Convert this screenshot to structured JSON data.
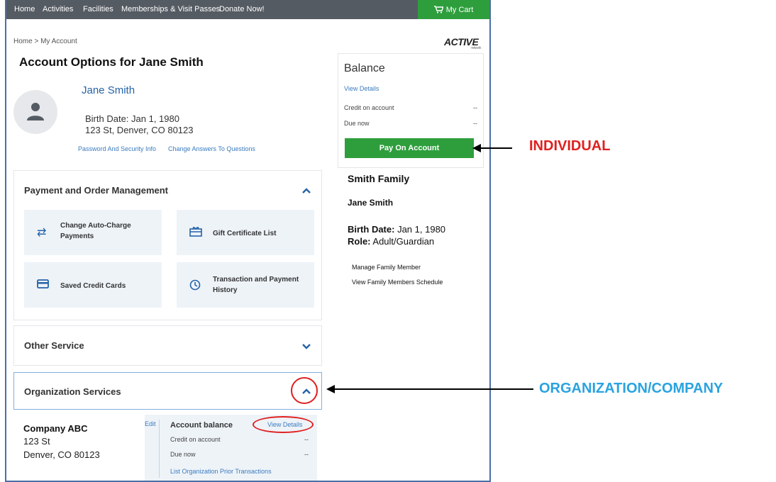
{
  "nav": {
    "items": [
      "Home",
      "Activities",
      "Facilities",
      "Memberships & Visit Passes",
      "Donate Now!"
    ],
    "cart": "My Cart"
  },
  "breadcrumb": "Home > My Account",
  "logo": {
    "text": "ACTIVE",
    "sub": "network"
  },
  "page_title": "Account Options for Jane Smith",
  "profile": {
    "name": "Jane Smith",
    "birth": "Birth Date: Jan 1, 1980",
    "address": "123 St, Denver, CO 80123",
    "link_password": "Password And Security Info",
    "link_answers": "Change Answers To Questions"
  },
  "payment_panel": {
    "title": "Payment and Order Management",
    "tiles": {
      "auto_charge": "Change Auto-Charge Payments",
      "gift": "Gift Certificate List",
      "cards": "Saved Credit Cards",
      "history": "Transaction and Payment History"
    }
  },
  "other_panel": {
    "title": "Other Service"
  },
  "org_panel": {
    "title": "Organization Services"
  },
  "org": {
    "name": "Company ABC",
    "street": "123 St",
    "city": "Denver, CO 80123",
    "edit": "Edit",
    "balance_title": "Account balance",
    "view_details": "View Details",
    "credit_label": "Credit on account",
    "credit_value": "--",
    "due_label": "Due now",
    "due_value": "--",
    "prior": "List Organization Prior Transactions"
  },
  "balance": {
    "title": "Balance",
    "view_details": "View Details",
    "credit_label": "Credit on account",
    "credit_value": "--",
    "due_label": "Due now",
    "due_value": "--",
    "pay_button": "Pay On Account"
  },
  "family": {
    "name": "Smith Family",
    "member": "Jane Smith",
    "birth_label": "Birth Date:",
    "birth_value": "Jan 1, 1980",
    "role_label": "Role:",
    "role_value": "Adult/Guardian",
    "manage_link": "Manage Family Member",
    "schedule_link": "View Family Members Schedule"
  },
  "annotations": {
    "individual": "INDIVIDUAL",
    "organization": "ORGANIZATION/COMPANY",
    "individual_color": "#e02020",
    "organization_color": "#2aa3e0"
  },
  "colors": {
    "accent_green": "#2e9e3d",
    "link_blue": "#3a7bbf",
    "nav_gray": "#555b63"
  }
}
